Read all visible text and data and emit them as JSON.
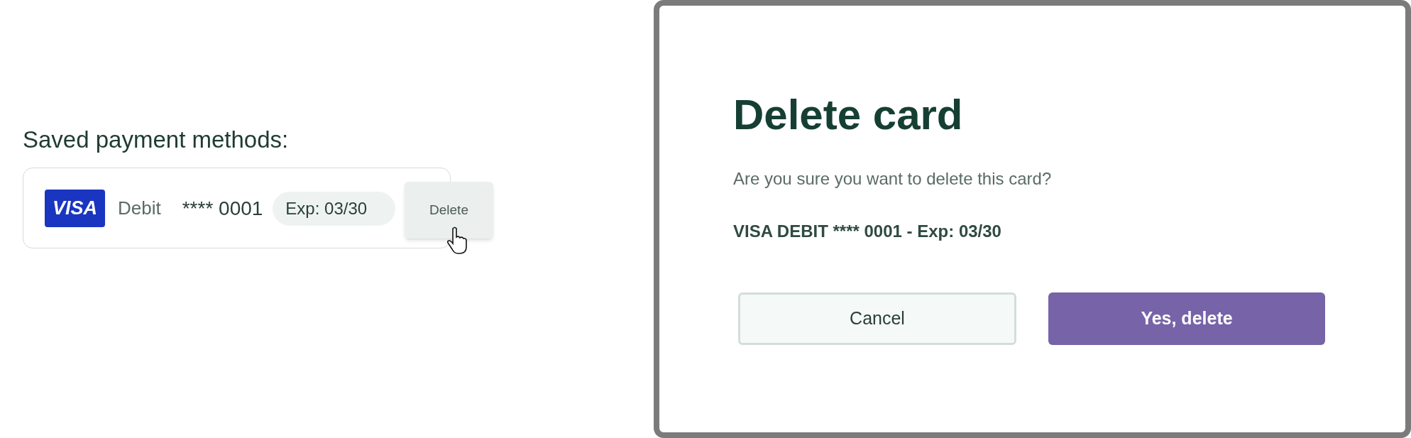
{
  "saved_methods": {
    "heading": "Saved payment methods:",
    "card": {
      "brand": "VISA",
      "type": "Debit",
      "number": "**** 0001",
      "expiry": "Exp: 03/30",
      "delete_label": "Delete"
    }
  },
  "dialog": {
    "title": "Delete card",
    "message": "Are you sure you want to delete this card?",
    "summary": "VISA DEBIT **** 0001 - Exp: 03/30",
    "buttons": [
      {
        "label": "Cancel",
        "kind": "secondary"
      },
      {
        "label": "Yes, delete",
        "kind": "primary"
      }
    ]
  }
}
